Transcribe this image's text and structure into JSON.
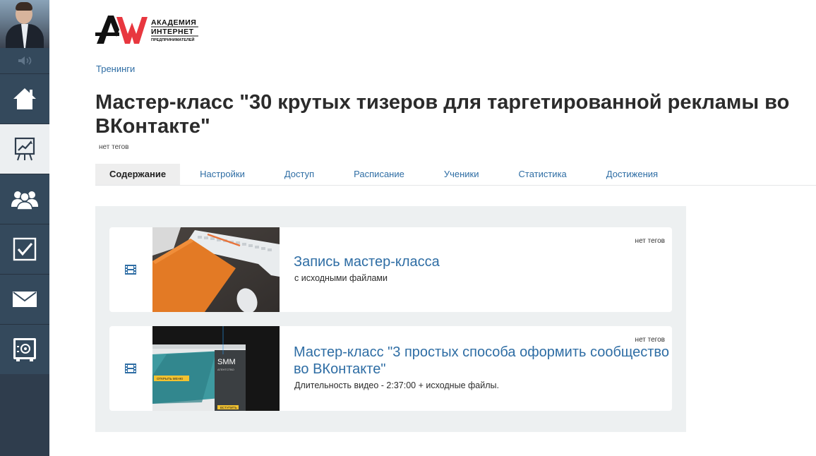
{
  "sidebar": {
    "items": [
      {
        "name": "home-icon",
        "active": false
      },
      {
        "name": "trainings-chart-icon",
        "active": true
      },
      {
        "name": "users-icon",
        "active": false
      },
      {
        "name": "tasks-check-icon",
        "active": false
      },
      {
        "name": "mail-icon",
        "active": false
      },
      {
        "name": "safe-icon",
        "active": false
      }
    ]
  },
  "logo": {
    "mark": "AW",
    "line1": "АКАДЕМИЯ",
    "line2": "ИНТЕРНЕТ",
    "line3": "ПРЕДПРИНИМАТЕЛЕЙ"
  },
  "breadcrumb": "Тренинги",
  "page_title": "Мастер-класс \"30 крутых тизеров для таргетированной рекламы во ВКонтакте\"",
  "page_tags": "нет тегов",
  "tabs": [
    {
      "label": "Содержание",
      "active": true
    },
    {
      "label": "Настройки",
      "active": false
    },
    {
      "label": "Доступ",
      "active": false
    },
    {
      "label": "Расписание",
      "active": false
    },
    {
      "label": "Ученики",
      "active": false
    },
    {
      "label": "Статистика",
      "active": false
    },
    {
      "label": "Достижения",
      "active": false
    }
  ],
  "lessons": [
    {
      "title": "Запись мастер-класса",
      "description": "с исходными файлами",
      "tags": "нет тегов",
      "icon": "film-icon"
    },
    {
      "title": "Мастер-класс \"3 простых способа оформить сообщество во ВКонтакте\"",
      "description": "Длительность видео - 2:37:00 + исходные файлы.",
      "tags": "нет тегов",
      "icon": "film-icon",
      "thumb_text": {
        "smm": "SMM",
        "agency": "АГЕНТСТВО",
        "menu_button": "ОТКРЫТЬ МЕНЮ",
        "join_button": "ВСТУПИТЬ"
      }
    }
  ],
  "colors": {
    "sidebar": "#34495c",
    "link": "#2e6da4",
    "content_bg": "#edf0f1",
    "logo_red": "#e8373f"
  }
}
